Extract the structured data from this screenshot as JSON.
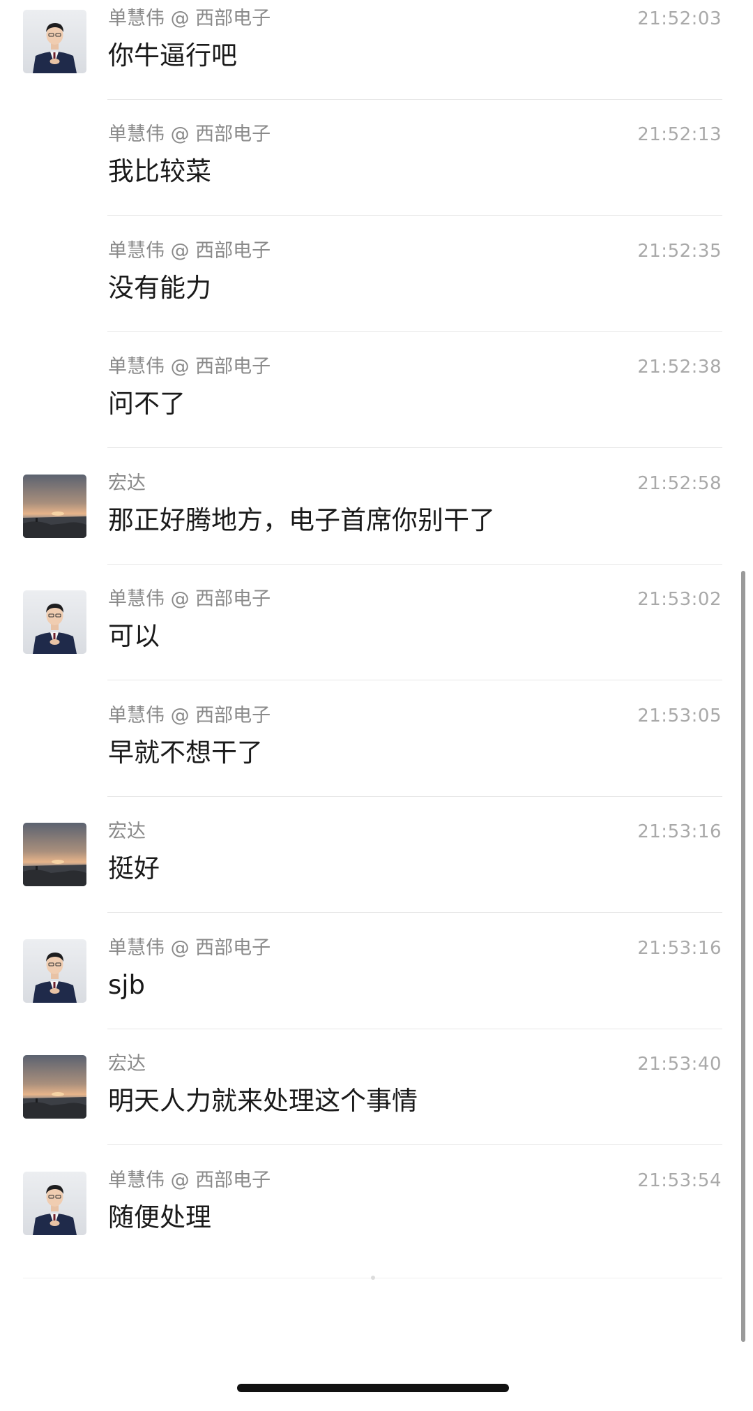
{
  "messages": [
    {
      "sender": "单慧伟 @ 西部电子",
      "time": "21:52:03",
      "text": "你牛逼行吧",
      "avatar": "man-in-suit"
    },
    {
      "sender": "单慧伟 @ 西部电子",
      "time": "21:52:13",
      "text": "我比较菜",
      "avatar": ""
    },
    {
      "sender": "单慧伟 @ 西部电子",
      "time": "21:52:35",
      "text": "没有能力",
      "avatar": ""
    },
    {
      "sender": "单慧伟 @ 西部电子",
      "time": "21:52:38",
      "text": "问不了",
      "avatar": ""
    },
    {
      "sender": "宏达",
      "time": "21:52:58",
      "text": "那正好腾地方，电子首席你别干了",
      "avatar": "sunset"
    },
    {
      "sender": "单慧伟 @ 西部电子",
      "time": "21:53:02",
      "text": "可以",
      "avatar": "man-in-suit"
    },
    {
      "sender": "单慧伟 @ 西部电子",
      "time": "21:53:05",
      "text": "早就不想干了",
      "avatar": ""
    },
    {
      "sender": "宏达",
      "time": "21:53:16",
      "text": "挺好",
      "avatar": "sunset"
    },
    {
      "sender": "单慧伟 @ 西部电子",
      "time": "21:53:16",
      "text": "sjb",
      "avatar": "man-in-suit"
    },
    {
      "sender": "宏达",
      "time": "21:53:40",
      "text": "明天人力就来处理这个事情",
      "avatar": "sunset"
    },
    {
      "sender": "单慧伟 @ 西部电子",
      "time": "21:53:54",
      "text": "随便处理",
      "avatar": "man-in-suit"
    }
  ],
  "colors": {
    "sender": "#8a8a8a",
    "time": "#a9a9a9",
    "message": "#1a1a1a",
    "divider": "#e6e6e6"
  }
}
